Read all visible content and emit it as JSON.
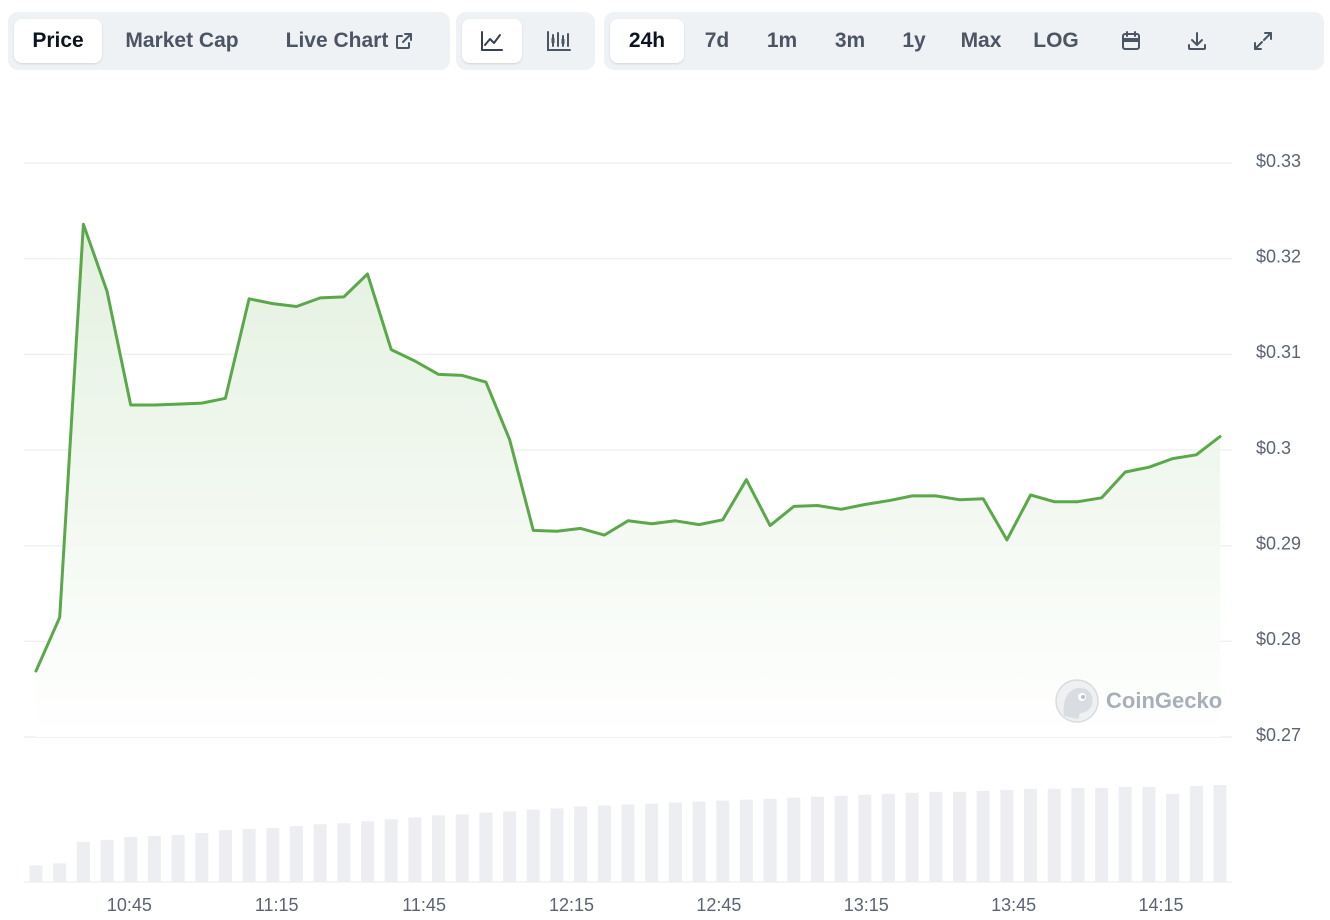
{
  "tabs": [
    {
      "label": "Price",
      "active": true
    },
    {
      "label": "Market Cap",
      "active": false
    },
    {
      "label": "Live Chart",
      "active": false,
      "icon": "external-link-icon"
    }
  ],
  "chart_types": [
    {
      "icon": "line-chart-icon",
      "active": true
    },
    {
      "icon": "candlestick-icon",
      "active": false
    }
  ],
  "ranges": [
    {
      "label": "24h",
      "active": true
    },
    {
      "label": "7d",
      "active": false
    },
    {
      "label": "1m",
      "active": false
    },
    {
      "label": "3m",
      "active": false
    },
    {
      "label": "1y",
      "active": false
    },
    {
      "label": "Max",
      "active": false
    },
    {
      "label": "LOG",
      "active": false
    }
  ],
  "tools": [
    {
      "icon": "calendar-icon"
    },
    {
      "icon": "download-icon"
    },
    {
      "icon": "expand-icon"
    }
  ],
  "watermark": "CoinGecko",
  "colors": {
    "line": "#5ba84b",
    "area": "#e0efdc",
    "volume": "#eceef1",
    "grid": "#eceef1",
    "toolbar_bg": "#eff2f5"
  },
  "chart_data": {
    "type": "area",
    "grid": true,
    "y_axis_position": "right",
    "ylim": [
      0.27,
      0.33
    ],
    "y_ticks": [
      0.33,
      0.32,
      0.31,
      0.3,
      0.29,
      0.28,
      0.27
    ],
    "y_tick_labels": [
      "$0.33",
      "$0.32",
      "$0.31",
      "$0.3",
      "$0.29",
      "$0.28",
      "$0.27"
    ],
    "x_ticks": [
      "10:45",
      "11:15",
      "11:45",
      "12:15",
      "12:45",
      "13:15",
      "13:45",
      "14:15"
    ],
    "x_tick_minutes": [
      645,
      675,
      705,
      735,
      765,
      795,
      825,
      855
    ],
    "x_start_minute": 626,
    "x_end_minute": 867,
    "series": [
      {
        "values": [
          0.2769,
          0.2825,
          0.3236,
          0.3166,
          0.3047,
          0.3047,
          0.3048,
          0.3049,
          0.3054,
          0.3158,
          0.3153,
          0.315,
          0.3159,
          0.316,
          0.3184,
          0.3105,
          0.3093,
          0.3079,
          0.3078,
          0.3071,
          0.3011,
          0.2916,
          0.2915,
          0.2918,
          0.2911,
          0.2926,
          0.2923,
          0.2926,
          0.2922,
          0.2927,
          0.2969,
          0.2921,
          0.2941,
          0.2942,
          0.2938,
          0.2943,
          0.2947,
          0.2952,
          0.2952,
          0.2948,
          0.2949,
          0.2906,
          0.2953,
          0.2946,
          0.2946,
          0.295,
          0.2977,
          0.2982,
          0.2991,
          0.2995,
          0.3014
        ]
      }
    ],
    "volume": [
      0.17,
      0.19,
      0.41,
      0.43,
      0.46,
      0.47,
      0.48,
      0.5,
      0.53,
      0.54,
      0.55,
      0.57,
      0.59,
      0.6,
      0.62,
      0.64,
      0.66,
      0.68,
      0.69,
      0.71,
      0.72,
      0.74,
      0.75,
      0.77,
      0.78,
      0.79,
      0.8,
      0.81,
      0.82,
      0.83,
      0.84,
      0.85,
      0.86,
      0.87,
      0.88,
      0.89,
      0.9,
      0.91,
      0.92,
      0.92,
      0.93,
      0.94,
      0.95,
      0.95,
      0.96,
      0.96,
      0.97,
      0.97,
      0.9,
      0.98,
      0.99
    ]
  }
}
